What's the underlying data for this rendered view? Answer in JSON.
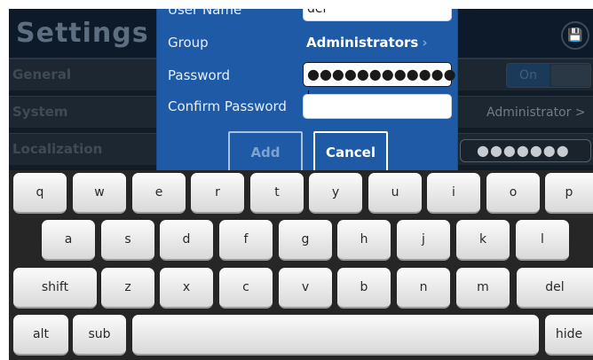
{
  "settings": {
    "title": "Settings",
    "rows": [
      {
        "label": "General"
      },
      {
        "label": "System",
        "value": "Administrator >"
      },
      {
        "label": "Localization",
        "masked_value": "●●●●●●●"
      }
    ],
    "toggle_label": "On",
    "save_icon": "save-icon"
  },
  "dialog": {
    "username_label": "User Name",
    "username_value": "del",
    "group_label": "Group",
    "group_value": "Administrators",
    "group_chevron": "›",
    "password_label": "Password",
    "password_masked": "●●●●●●●●●●●●",
    "confirm_label": "Confirm Password",
    "confirm_value": "",
    "add_label": "Add",
    "cancel_label": "Cancel"
  },
  "keyboard": {
    "row1": [
      "q",
      "w",
      "e",
      "r",
      "t",
      "y",
      "u",
      "i",
      "o",
      "p"
    ],
    "row2": [
      "a",
      "s",
      "d",
      "f",
      "g",
      "h",
      "j",
      "k",
      "l"
    ],
    "row3": [
      "shift",
      "z",
      "x",
      "c",
      "v",
      "b",
      "n",
      "m",
      "del"
    ],
    "row4": [
      "alt",
      "sub",
      "",
      "hide"
    ]
  }
}
